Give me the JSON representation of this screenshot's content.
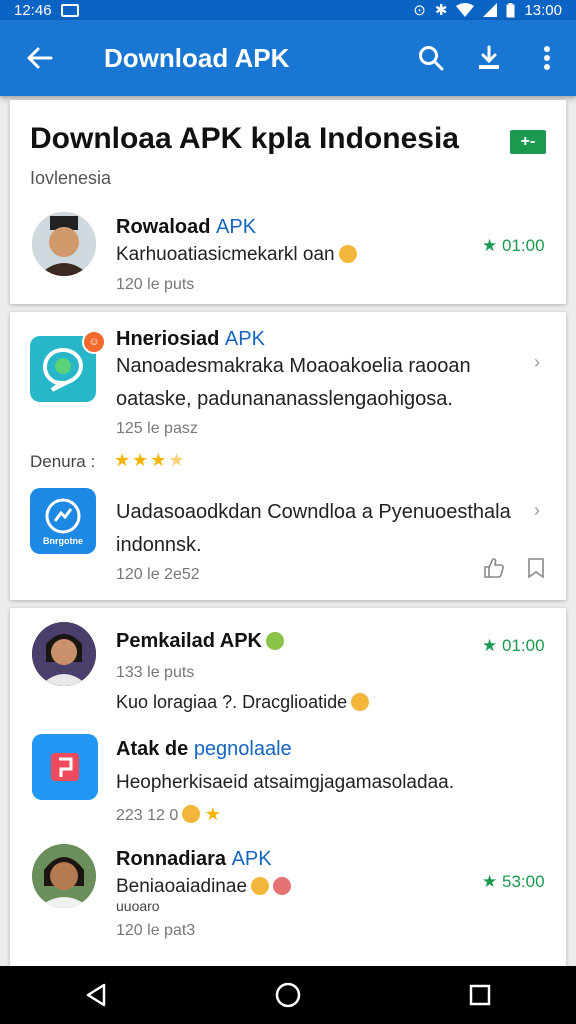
{
  "status_bar": {
    "time_left": "12:46",
    "time_right": "13:00"
  },
  "app_bar": {
    "title": "Download APK"
  },
  "header_card": {
    "title": "Downloaa APK kpla Indonesia",
    "subtitle": "Iovlenesia",
    "chip": "+-"
  },
  "card1": {
    "name_bold": "Rowaload",
    "name_accent": "APK",
    "desc": "Karhuoatiasicmekarkl oan",
    "meta": "120 le puts",
    "rating": "01:00"
  },
  "card2": {
    "item1": {
      "name_bold": "Hneriosiad",
      "name_accent": "APK",
      "desc": "Nanoadesmakraka Moaoakoelia raooan oataske, padunananasslengaohigosa.",
      "meta": "125 le pasz"
    },
    "rating_label": "Denura :",
    "item2": {
      "desc": "Uadasoaodkdan Cowndloa a Pyenuoesthala indonnsk.",
      "meta": "120 le 2e52",
      "icon_label": "Bnrgotne"
    }
  },
  "card3": {
    "item1": {
      "name": "Pemkailad APK",
      "meta": "133 le puts",
      "desc": "Kuo loragiaa ?. Dracglioatide",
      "rating": "01:00"
    },
    "item2": {
      "name_bold": "Atak de",
      "name_accent": "pegnolaale",
      "desc": "Heopherkisaeid atsaimgjagamasoladaa.",
      "meta": "223 12 0"
    },
    "item3": {
      "name_bold": "Ronnadiara",
      "name_accent": "APK",
      "desc": "Beniaoaiadinae",
      "desc2": "uuoaro",
      "meta": "120 le pat3",
      "rating": "53:00"
    }
  }
}
